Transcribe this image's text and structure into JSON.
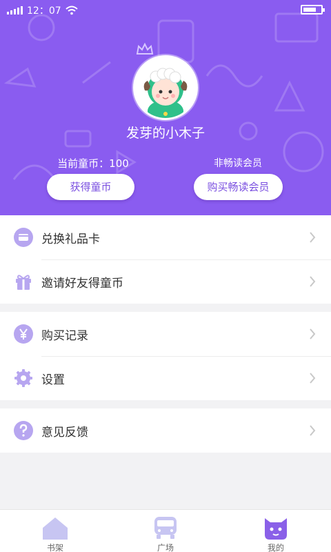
{
  "status_bar": {
    "time": "12：07"
  },
  "profile": {
    "username": "发芽的小木子",
    "coin_label": "当前童币：100",
    "vip_status": "非畅读会员",
    "get_coins_button": "获得童币",
    "buy_vip_button": "购买畅读会员"
  },
  "menu": {
    "group1": [
      {
        "label": "兑换礼品卡",
        "icon": "card-icon"
      },
      {
        "label": "邀请好友得童币",
        "icon": "gift-icon"
      }
    ],
    "group2": [
      {
        "label": "购买记录",
        "icon": "yen-icon"
      },
      {
        "label": "设置",
        "icon": "gear-icon"
      }
    ],
    "group3": [
      {
        "label": "意见反馈",
        "icon": "question-icon"
      }
    ]
  },
  "tabbar": {
    "tabs": [
      {
        "label": "书架",
        "icon": "house-icon",
        "active": false
      },
      {
        "label": "广场",
        "icon": "bus-icon",
        "active": false
      },
      {
        "label": "我的",
        "icon": "monster-icon",
        "active": true
      }
    ]
  },
  "colors": {
    "header_bg": "#8a5cf0",
    "accent": "#7a4fe0",
    "icon_light": "#b7a6f0",
    "icon_dark": "#8a60e8"
  }
}
